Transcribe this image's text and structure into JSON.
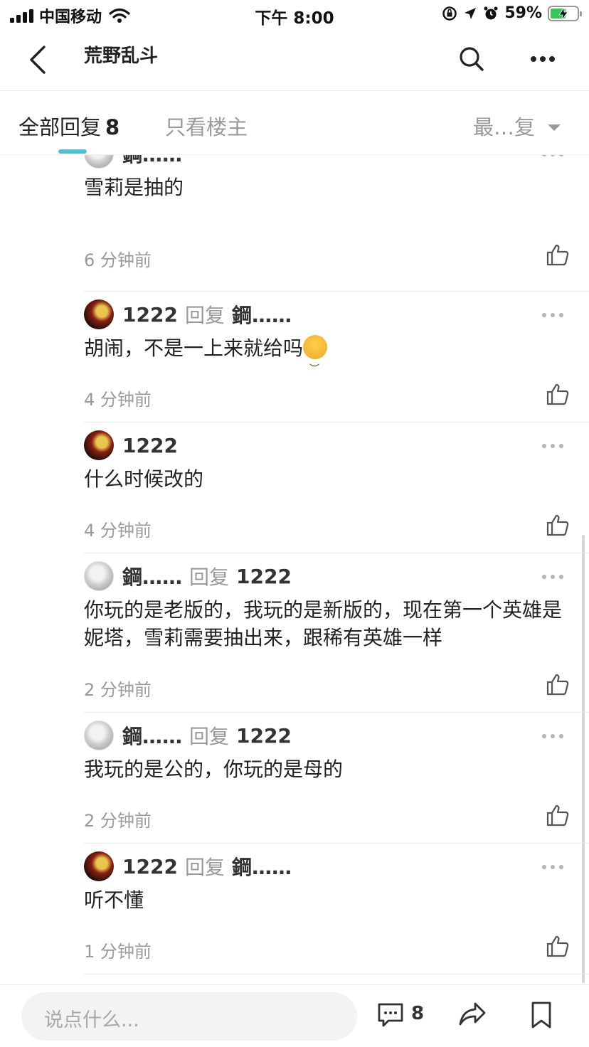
{
  "status_bar": {
    "carrier": "中国移动",
    "time": "下午 8:00",
    "battery": "59%",
    "battery_level": 0.59,
    "icons": [
      "signal-icon",
      "wifi-icon",
      "orientation-lock-icon",
      "location-icon",
      "alarm-icon",
      "battery-charging-icon"
    ]
  },
  "nav": {
    "title": "荒野乱斗",
    "icons": [
      "back-chevron-icon",
      "search-icon",
      "more-icon"
    ]
  },
  "tabs": {
    "all_label": "全部回复",
    "all_count": "8",
    "host_label": "只看楼主",
    "sort_label": "最…复"
  },
  "comments": [
    {
      "user": "鋼……",
      "reply_word": "",
      "target": "",
      "text": "雪莉是抽的",
      "time": "6 分钟前",
      "avatar": "gray"
    },
    {
      "user": "1222",
      "reply_word": "回复",
      "target": "鋼……",
      "text": "胡闹，不是一上来就给吗",
      "emoji": "angry-face-emoji",
      "time": "4 分钟前",
      "avatar": "dark"
    },
    {
      "user": "1222",
      "reply_word": "",
      "target": "",
      "text": "什么时候改的",
      "time": "4 分钟前",
      "avatar": "dark"
    },
    {
      "user": "鋼……",
      "reply_word": "回复",
      "target": "1222",
      "text": "你玩的是老版的，我玩的是新版的，现在第一个英雄是妮塔，雪莉需要抽出来，跟稀有英雄一样",
      "time": "2 分钟前",
      "avatar": "gray"
    },
    {
      "user": "鋼……",
      "reply_word": "回复",
      "target": "1222",
      "text": "我玩的是公的，你玩的是母的",
      "time": "2 分钟前",
      "avatar": "gray"
    },
    {
      "user": "1222",
      "reply_word": "回复",
      "target": "鋼……",
      "text": "听不懂",
      "time": "1 分钟前",
      "avatar": "dark"
    }
  ],
  "bottom_bar": {
    "placeholder": "说点什么...",
    "comment_count": "8",
    "icons": [
      "comment-icon",
      "share-icon",
      "bookmark-icon"
    ]
  },
  "colors": {
    "accent": "#4fc3d5",
    "battery_green": "#35c759",
    "muted_text": "#9a9a9a"
  }
}
